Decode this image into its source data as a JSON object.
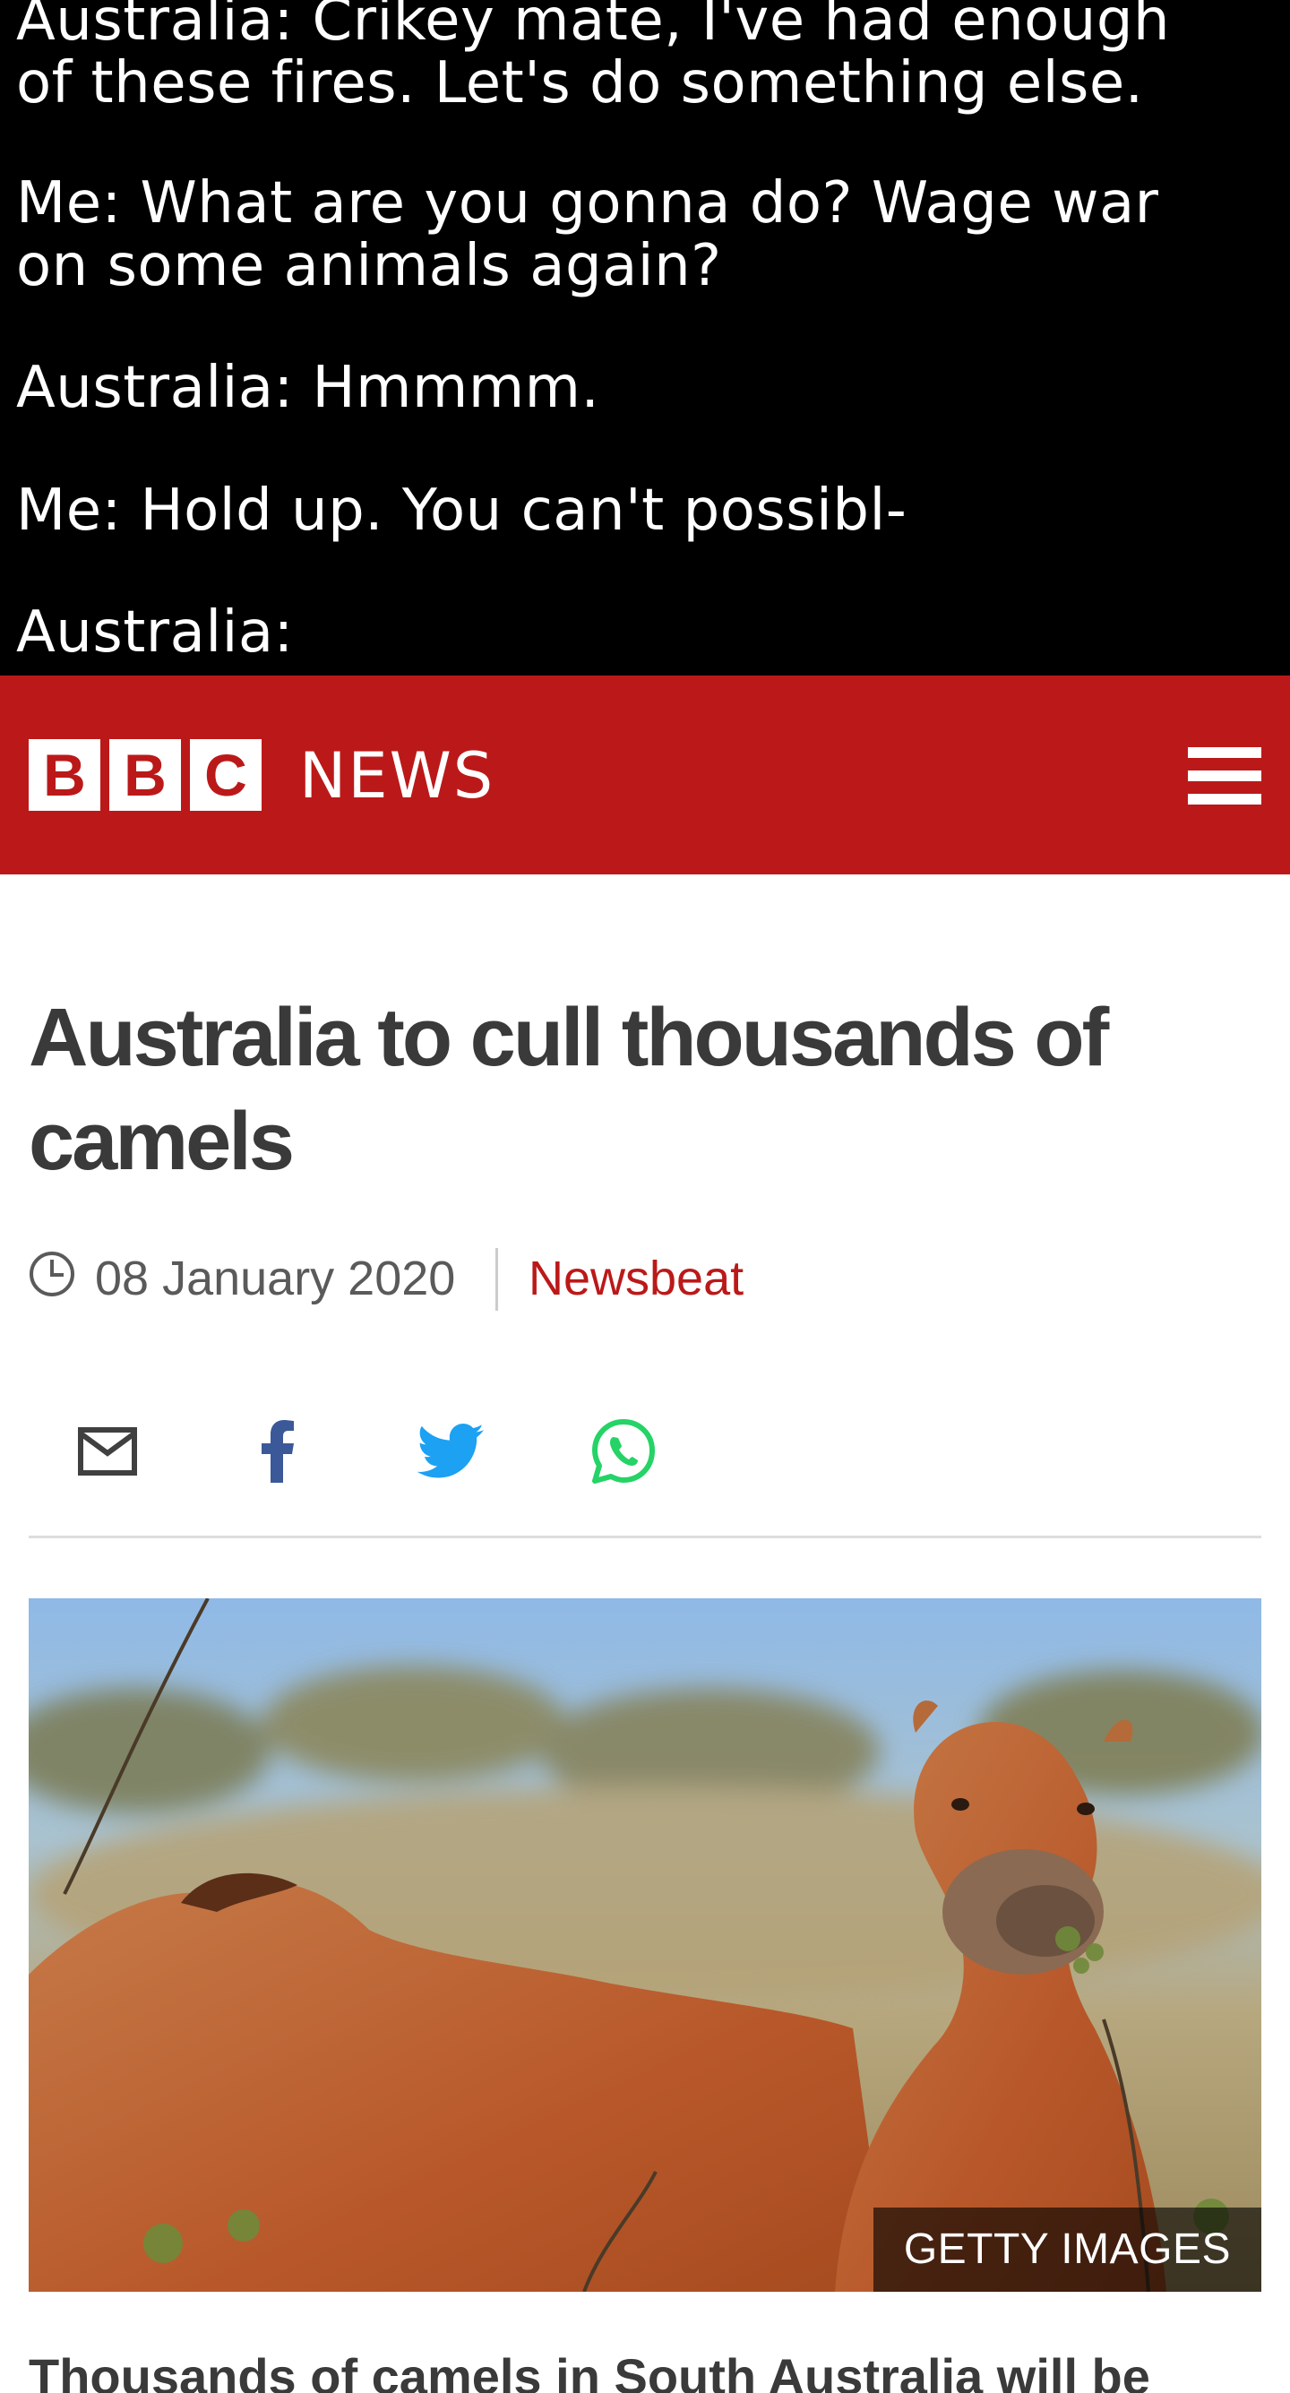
{
  "meme": {
    "lines": [
      "Australia: Crikey mate, I've had enough",
      "of these fires. Let's do something else.",
      "Me: What are you gonna do? Wage war",
      "on some animals again?",
      "Australia: Hmmmm.",
      "Me: Hold up. You can't possibl-",
      "Australia:"
    ]
  },
  "masthead": {
    "logo_letters": [
      "B",
      "B",
      "C"
    ],
    "logo_word": "NEWS",
    "menu_icon": "hamburger-icon",
    "brand_color": "#bb1919"
  },
  "article": {
    "headline": "Australia to cull thousands of camels",
    "date": "08 January 2020",
    "section": "Newsbeat",
    "share": [
      {
        "name": "email",
        "icon": "envelope-icon",
        "color": "#404040"
      },
      {
        "name": "facebook",
        "icon": "facebook-icon",
        "color": "#3b5998"
      },
      {
        "name": "twitter",
        "icon": "twitter-icon",
        "color": "#1da1f2"
      },
      {
        "name": "whatsapp",
        "icon": "whatsapp-icon",
        "color": "#25d366"
      }
    ],
    "image_credit": "GETTY IMAGES",
    "lede": "Thousands of camels in South Australia will be"
  }
}
